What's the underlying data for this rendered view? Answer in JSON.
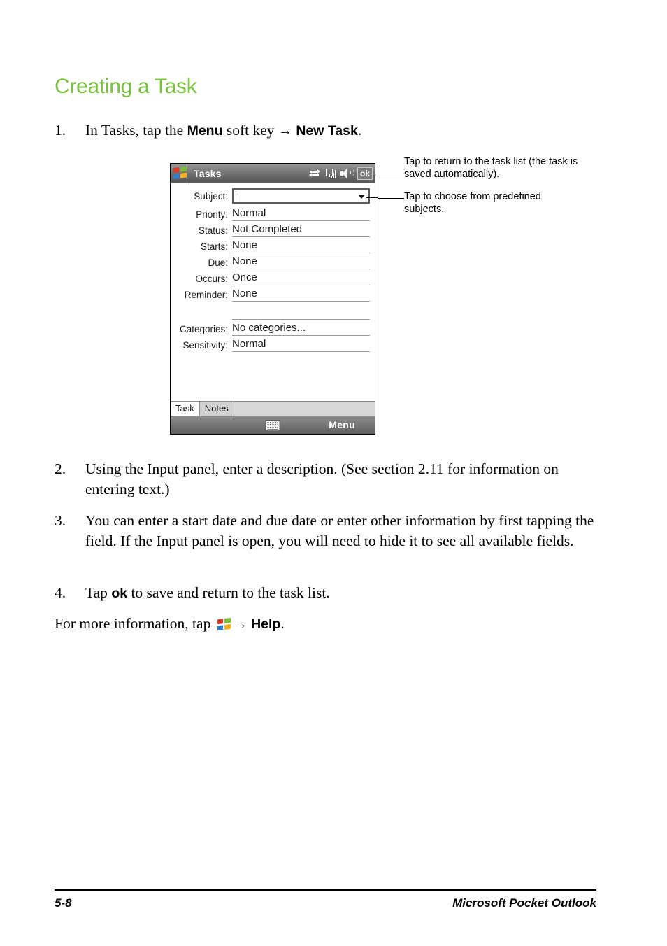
{
  "page": {
    "heading": "Creating a Task",
    "footer_page_number": "5-8",
    "footer_section": "Microsoft Pocket Outlook",
    "accent_color": "#7ac143"
  },
  "steps": [
    {
      "number": "1.",
      "text_part1": "In Tasks, tap the ",
      "bold1": "Menu",
      "text_part2": " soft key ",
      "arrow": "→",
      "bold2": "New Task",
      "text_part3": "."
    },
    {
      "number": "2.",
      "text": "Using the Input panel, enter a description. (See section 2.11 for information on entering text.)"
    },
    {
      "number": "3.",
      "text": "You can enter a start date and due date or enter other information by first tapping the field. If the Input panel is open, you will need to hide it to see all available fields."
    },
    {
      "number": "4.",
      "text_part1": "Tap ",
      "bold1": "ok",
      "text_part2": " to save and return to the task list."
    }
  ],
  "more_info": {
    "text_part1": "For more information, tap ",
    "icon": "windows-start-icon",
    "arrow": "→",
    "bold1": "Help",
    "text_part2": "."
  },
  "pda": {
    "titlebar": {
      "start_icon": "windows-start-icon",
      "title": "Tasks",
      "status_icons": [
        "connectivity-icon",
        "signal-strength-icon",
        "volume-icon"
      ],
      "ok_label": "ok"
    },
    "form": {
      "subject": {
        "label": "Subject:",
        "value": "",
        "dropdown_icon": "chevron-down-icon"
      },
      "fields": [
        {
          "label": "Priority:",
          "value": "Normal"
        },
        {
          "label": "Status:",
          "value": "Not Completed"
        },
        {
          "label": "Starts:",
          "value": "None"
        },
        {
          "label": "Due:",
          "value": "None"
        },
        {
          "label": "Occurs:",
          "value": "Once"
        },
        {
          "label": "Reminder:",
          "value": "None"
        },
        {
          "label": "",
          "value": ""
        },
        {
          "label": "Categories:",
          "value": "No categories..."
        },
        {
          "label": "Sensitivity:",
          "value": "Normal"
        }
      ]
    },
    "tabs": [
      {
        "label": "Task",
        "active": true
      },
      {
        "label": "Notes",
        "active": false
      }
    ],
    "softbar": {
      "keyboard_icon": "keyboard-icon",
      "menu_label": "Menu"
    }
  },
  "callouts": [
    {
      "text": "Tap to return to the task list (the task is saved automatically)."
    },
    {
      "text": "Tap to choose from predefined subjects."
    }
  ]
}
